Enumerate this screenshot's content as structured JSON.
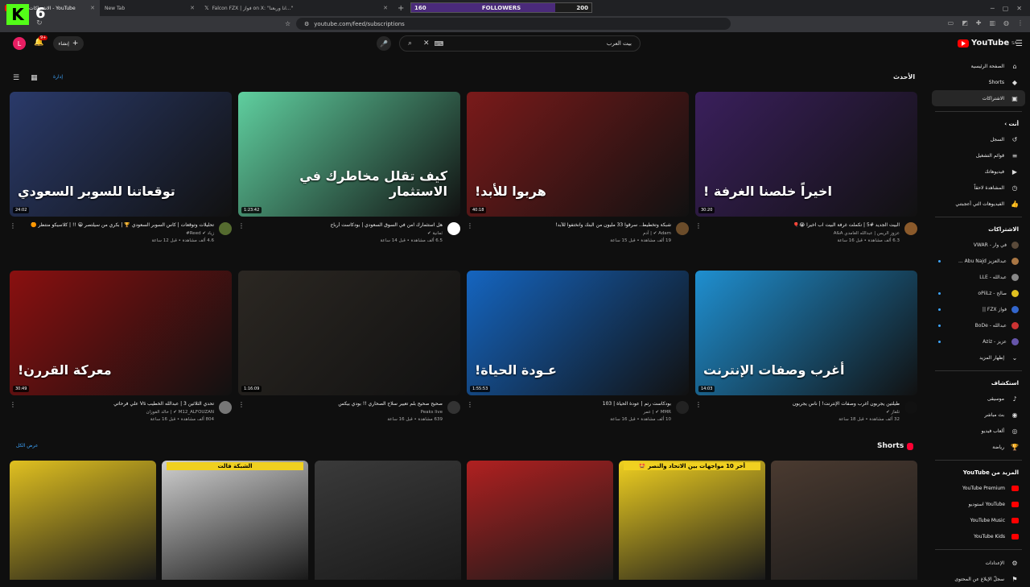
{
  "browser": {
    "tabs": [
      {
        "label": "(135) الاشتراكات - YouTube",
        "active": true
      },
      {
        "label": "New Tab",
        "active": false
      },
      {
        "label": "Falcon FZX | فواز on X: \"انا وربعنا...\"",
        "active": false
      }
    ],
    "url": "youtube.com/feed/subscriptions"
  },
  "overlay": {
    "kick_logo": "K",
    "kick_count": "6",
    "followers_label": "FOLLOWERS",
    "followers_current": "160",
    "followers_goal": "200",
    "followers_progress": 0.8
  },
  "header": {
    "avatar_letter": "L",
    "notification_count": "9+",
    "create_label": "إنشاء",
    "search_text": "بيت العرب",
    "logo_text": "YouTube",
    "logo_region": "SA"
  },
  "feed": {
    "latest_label": "الأحدث",
    "manage_label": "إدارة",
    "videos": [
      {
        "title": "البيت الجديد #5 | تكملت غرفة البيت اب اخيرا 😭🎈",
        "channel": "عزوز الريس | عبدالله الغامدي A&A",
        "stats": "6.3 ألف مشاهدة • قبل 16 ساعة",
        "duration": "30:20",
        "thumb_text": "اخيراً خلصنا الغرفة !",
        "thumb_color": "#3a1f5c",
        "avatar_color": "#8b5a2b"
      },
      {
        "title": "شبكة وتخطيط.. سرقوا 33 مليون من البنك وانختفوا للأبد!",
        "channel": "Adam ✔ | آدم",
        "stats": "19 ألف مشاهدة • قبل 15 ساعة",
        "duration": "40:18",
        "thumb_text": "هربوا للأبد!",
        "thumb_color": "#7a1a1a",
        "avatar_color": "#6b4c2a"
      },
      {
        "title": "هل استثمارك آمن في السوق السعودي | بودكاست أرباح",
        "channel": "ثمانية ✔",
        "stats": "6.5 ألف مشاهدة • قبل 14 ساعة",
        "duration": "1:23:42",
        "thumb_text": "كيف تقلل مخاطرك في الاستثمار",
        "thumb_color": "#5fcf9f",
        "avatar_color": "#ffffff"
      },
      {
        "title": "تحليلات وتوقعات | كأس السوبر السعودي 🏆 | بكري من سيلتصر 😀 !! | كلاسيكو منتظر 🟠",
        "channel": "زياد ✔ Reed#",
        "stats": "4.6 ألف مشاهدة • قبل 12 ساعة",
        "duration": "24:02",
        "thumb_text": "توقعاتنا للسوبر السعودي",
        "thumb_color": "#2a3a6a",
        "avatar_color": "#556b2f"
      },
      {
        "title": "طيلتين يجربون أغرب وصفات الإنترنت! | ناس يجربون",
        "channel": "تلفاز ✔",
        "stats": "32 ألف مشاهدة • قبل 18 ساعة",
        "duration": "14:03",
        "thumb_text": "أغرب وصفات الإنترنت",
        "thumb_color": "#1f8fd0",
        "avatar_color": "#111111"
      },
      {
        "title": "بودكاست رتم | عودة الحياة | 103",
        "channel": "MMR ✔ | عمر",
        "stats": "10 ألف مشاهدة • قبل 16 ساعة",
        "duration": "1:55:53",
        "thumb_text": "عـودة الحياة!",
        "thumb_color": "#1565c0",
        "avatar_color": "#222222"
      },
      {
        "title": "صحيح صحيح بلم تعيير سلاح الصحاري !! بودي بيكس",
        "channel": "Peaks live",
        "stats": "639 مشاهدة • قبل 16 ساعة",
        "duration": "1:16:09",
        "thumb_text": "",
        "thumb_color": "#2b2722",
        "avatar_color": "#333333"
      },
      {
        "title": "تحدي الثلاثين 3 | عبدالله الخطيب Vs علي فرحاتي",
        "channel": "M12_ALFOUZAN ✔ | خالد الفوزان",
        "stats": "804 ألف مشاهدة • قبل 16 ساعة",
        "duration": "30:49",
        "thumb_text": "معركة القررن!",
        "thumb_color": "#8a1010",
        "avatar_color": "#777777"
      }
    ],
    "shorts_label": "Shorts",
    "show_all_label": "عرض الكل",
    "shorts": [
      {
        "thumb_color": "#e0c020",
        "text": ""
      },
      {
        "thumb_color": "#cfcfcf",
        "text": "الشبكة قالت"
      },
      {
        "thumb_color": "#3a3a3a",
        "text": ""
      },
      {
        "thumb_color": "#b02020",
        "text": ""
      },
      {
        "thumb_color": "#f0d020",
        "text": "أخر 10 مواجهات بين الاتحاد والنصر 🤩"
      },
      {
        "thumb_color": "#4a3a30",
        "text": ""
      }
    ]
  },
  "sidebar": {
    "nav": [
      {
        "label": "الصفحة الرئيسية",
        "icon": "⌂"
      },
      {
        "label": "Shorts",
        "icon": "◆"
      },
      {
        "label": "الاشتراكات",
        "icon": "▣",
        "active": true
      }
    ],
    "you_label": "أنت ›",
    "you_items": [
      {
        "label": "السجل",
        "icon": "↺"
      },
      {
        "label": "قوائم التشغيل",
        "icon": "≡"
      },
      {
        "label": "فيديوهاتك",
        "icon": "▶"
      },
      {
        "label": "المشاهدة لاحقاً",
        "icon": "◷"
      },
      {
        "label": "الفيديوهات التي أعجبتني",
        "icon": "👍"
      }
    ],
    "subs_label": "الاشتراكات",
    "subs": [
      {
        "label": "في وار - VWAR",
        "color": "#5a4a3a",
        "dot": false
      },
      {
        "label": "عبدالعزيز Abu Najd ...",
        "color": "#aa7744",
        "dot": true
      },
      {
        "label": "عبدالله - LLE",
        "color": "#888888",
        "dot": false
      },
      {
        "label": "صالح - oPiiLz",
        "color": "#e0c020",
        "dot": true
      },
      {
        "label": "فواز FZX ||",
        "color": "#3366cc",
        "dot": true
      },
      {
        "label": "عبدالله - BoDe",
        "color": "#cc3333",
        "dot": true
      },
      {
        "label": "عزيز - Aziz",
        "color": "#6655aa",
        "dot": true
      }
    ],
    "show_more_label": "إظهار المزيد",
    "explore_label": "استكشاف",
    "explore_items": [
      {
        "label": "موسيقى",
        "icon": "♪"
      },
      {
        "label": "بث مباشر",
        "icon": "◉"
      },
      {
        "label": "ألعاب فيديو",
        "icon": "◎"
      },
      {
        "label": "رياضة",
        "icon": "🏆"
      }
    ],
    "more_label": "المزيد من YouTube",
    "more_items": [
      {
        "label": "YouTube Premium"
      },
      {
        "label": "YouTube استوديو"
      },
      {
        "label": "YouTube Music"
      },
      {
        "label": "YouTube Kids"
      }
    ],
    "settings_label": "الإعدادات",
    "report_label": "سجلّ الإبلاغ عن المحتوى"
  }
}
